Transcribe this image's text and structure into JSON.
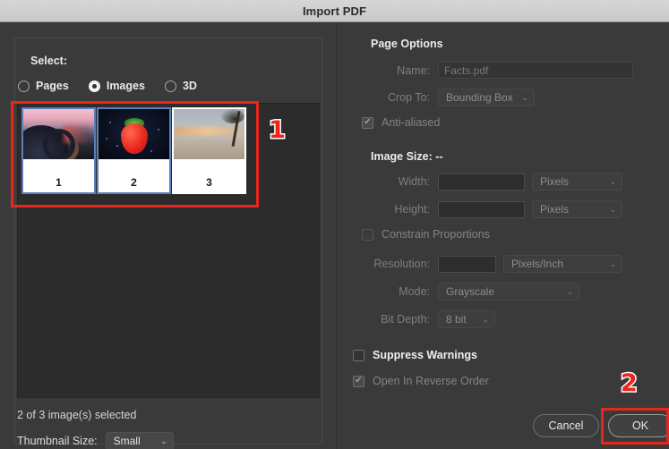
{
  "window": {
    "title": "Import PDF"
  },
  "left": {
    "group_label": "Select:",
    "radios": [
      {
        "label": "Pages",
        "selected": false
      },
      {
        "label": "Images",
        "selected": true
      },
      {
        "label": "3D",
        "selected": false
      }
    ],
    "thumbnails": [
      {
        "caption": "1",
        "subject": "car-dashboard-sunset",
        "selected": true
      },
      {
        "caption": "2",
        "subject": "strawberry-dark",
        "selected": true
      },
      {
        "caption": "3",
        "subject": "beach-palm-sunset",
        "selected": false
      }
    ],
    "selection_status": "2 of 3 image(s) selected",
    "thumbnail_size_label": "Thumbnail Size:",
    "thumbnail_size_value": "Small"
  },
  "right": {
    "page_options_title": "Page Options",
    "name_label": "Name:",
    "name_value": "Facts.pdf",
    "crop_to_label": "Crop To:",
    "crop_to_value": "Bounding Box",
    "anti_aliased_label": "Anti-aliased",
    "image_size_title": "Image Size: --",
    "width_label": "Width:",
    "width_value": "",
    "width_unit": "Pixels",
    "height_label": "Height:",
    "height_value": "",
    "height_unit": "Pixels",
    "constrain_label": "Constrain Proportions",
    "resolution_label": "Resolution:",
    "resolution_value": "",
    "resolution_unit": "Pixels/Inch",
    "mode_label": "Mode:",
    "mode_value": "Grayscale",
    "bit_depth_label": "Bit Depth:",
    "bit_depth_value": "8 bit",
    "suppress_warnings_label": "Suppress Warnings",
    "open_reverse_label": "Open In Reverse Order"
  },
  "footer": {
    "cancel_label": "Cancel",
    "ok_label": "OK"
  },
  "annotations": {
    "one": "1",
    "two": "2",
    "color": "#e8261b"
  },
  "icons": {
    "caret": "⌄",
    "check": "✔"
  }
}
